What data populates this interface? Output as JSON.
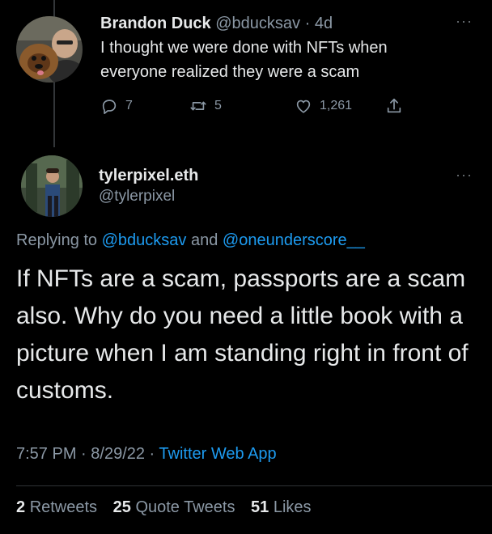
{
  "parent_tweet": {
    "display_name": "Brandon Duck",
    "handle": "@bducksav",
    "time": "· 4d",
    "text": "I thought we were done with NFTs when everyone realized they were a scam",
    "more": "···",
    "actions": {
      "replies": "7",
      "retweets": "5",
      "likes": "1,261"
    }
  },
  "main_tweet": {
    "display_name": "tylerpixel.eth",
    "handle": "@tylerpixel",
    "more": "···",
    "replying_prefix": "Replying to ",
    "replying_user1": "@bducksav",
    "replying_and": " and ",
    "replying_user2": "@oneunderscore__",
    "text": "If NFTs are a scam, passports are a scam also. Why do you need a little book with a picture when I am standing right in front of customs.",
    "time": "7:57 PM",
    "sep1": " · ",
    "date": "8/29/22",
    "sep2": " · ",
    "source": "Twitter Web App",
    "stats": {
      "retweets_count": "2",
      "retweets_label": "Retweets",
      "quotes_count": "25",
      "quotes_label": "Quote Tweets",
      "likes_count": "51",
      "likes_label": "Likes"
    }
  },
  "colors": {
    "background": "#000000",
    "text": "#e7e9ea",
    "muted": "#8b98a5",
    "link": "#1d9bf0"
  },
  "icons": [
    "reply-icon",
    "retweet-icon",
    "like-icon",
    "share-icon",
    "more-icon"
  ]
}
